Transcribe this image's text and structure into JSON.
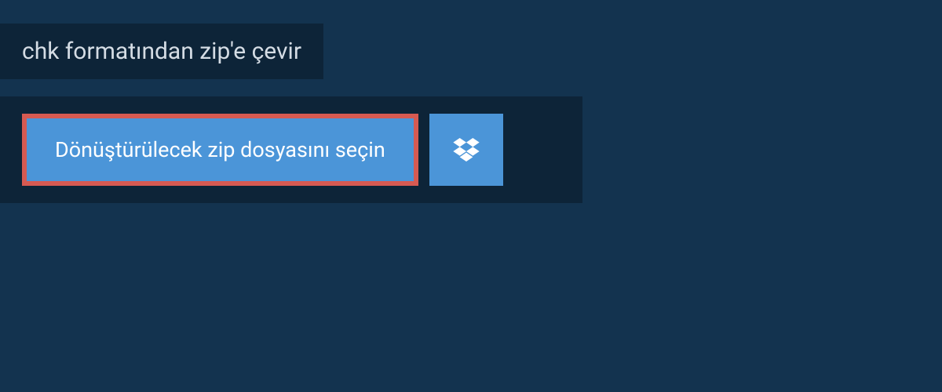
{
  "header": {
    "title": "chk formatından zip'e çevir"
  },
  "upload": {
    "choose_file_label": "Dönüştürülecek zip dosyasını seçin"
  },
  "colors": {
    "page_bg": "#13334f",
    "panel_bg": "#0d2438",
    "button_bg": "#4b95d8",
    "button_border": "#d65a52",
    "text_light": "#ffffff",
    "header_text": "#d4dce4"
  }
}
